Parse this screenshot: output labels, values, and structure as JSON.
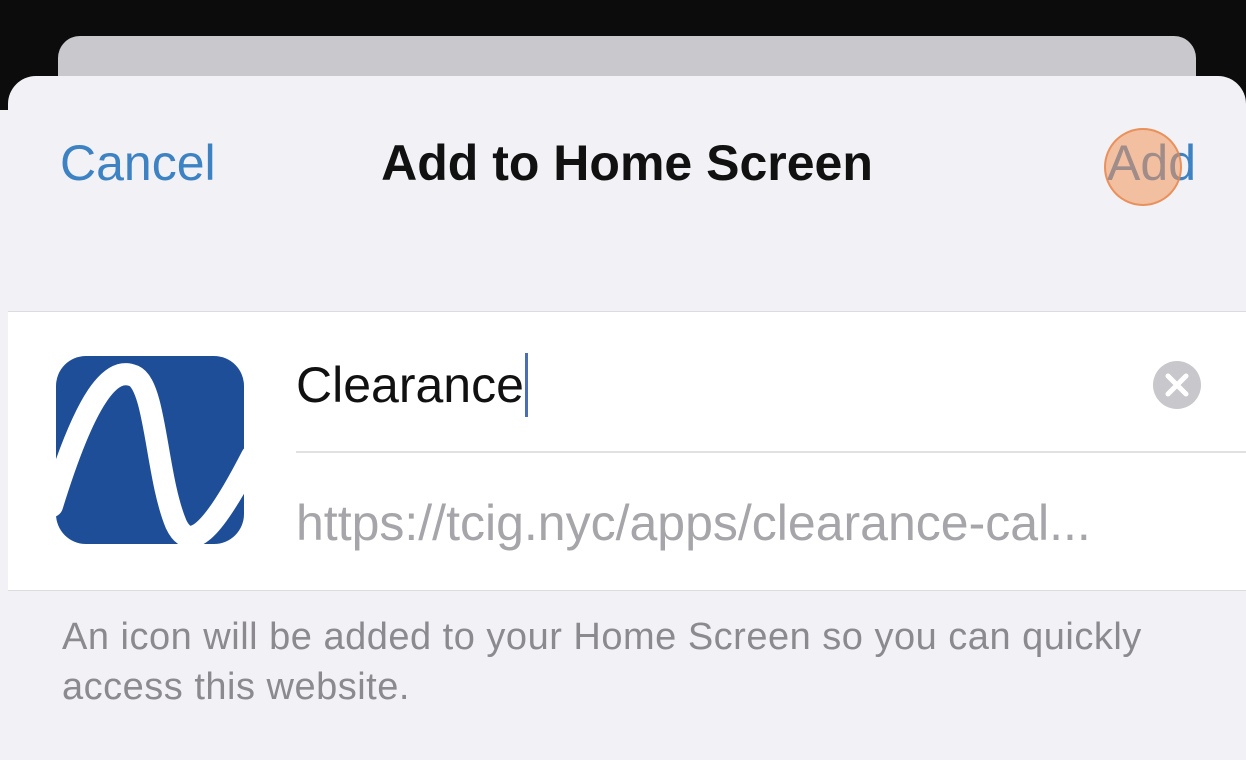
{
  "sheet": {
    "title": "Add to Home Screen",
    "cancel_label": "Cancel",
    "add_label": "Add"
  },
  "app": {
    "icon": "clearance-app-icon",
    "name_value": "Clearance",
    "url": "https://tcig.nyc/apps/clearance-cal..."
  },
  "footer": {
    "note": "An icon will be added to your Home Screen so you can quickly access this website."
  },
  "colors": {
    "accent": "#3d82c3",
    "icon_blue": "#1f4e98",
    "tap_indicator": "#f3965a"
  }
}
